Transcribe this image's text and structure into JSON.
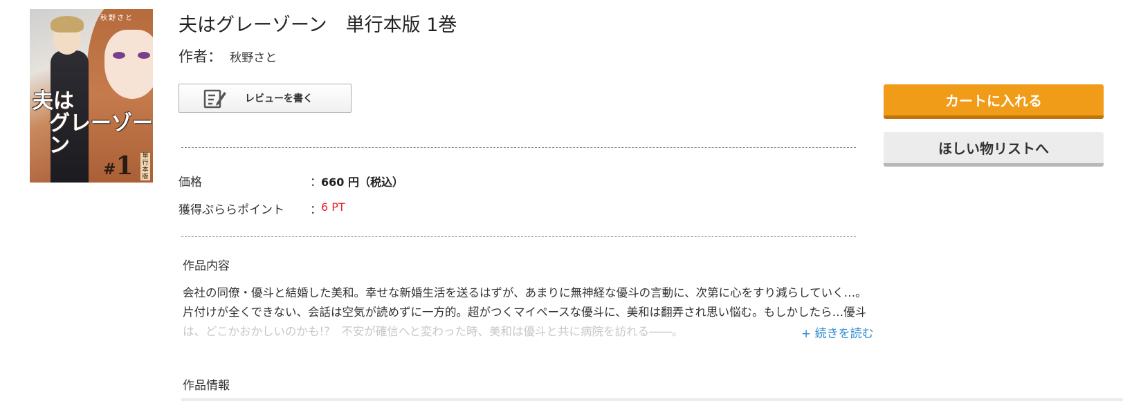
{
  "cover": {
    "title_line1": "夫は",
    "title_line2": "グレーゾーン",
    "author": "秋野さと",
    "volume": "1",
    "tag": "単行本版"
  },
  "product": {
    "title": "夫はグレーゾーン　単行本版 1巻",
    "author_label": "作者：",
    "author_name": "秋野さと"
  },
  "actions": {
    "review_label": "レビューを書く",
    "cart_label": "カートに入れる",
    "wishlist_label": "ほしい物リストへ"
  },
  "details": {
    "price_label": "価格",
    "price_value": "660 円（税込）",
    "points_label": "獲得ぷららポイント",
    "points_value": "6 PT",
    "colon": "："
  },
  "description": {
    "section_title": "作品内容",
    "lines": [
      "会社の同僚・優斗と結婚した美和。幸せな新婚生活を送るはずが、あまりに無神経な優斗の言動に、次第に心をすり減らしていく…。",
      "片付けが全くできない、会話は空気が読めずに一方的。超がつくマイペースな優斗に、美和は翻弄され思い悩む。もしかしたら…優斗",
      "は、どこかおかしいのかも!?　不安が確信へと変わった時、美和は優斗と共に病院を訪れる――。"
    ],
    "read_more": "+ 続きを読む"
  },
  "info": {
    "section_title": "作品情報"
  },
  "colors": {
    "cart": "#f19c19",
    "points": "#e8202a",
    "link": "#2a8bd1"
  }
}
